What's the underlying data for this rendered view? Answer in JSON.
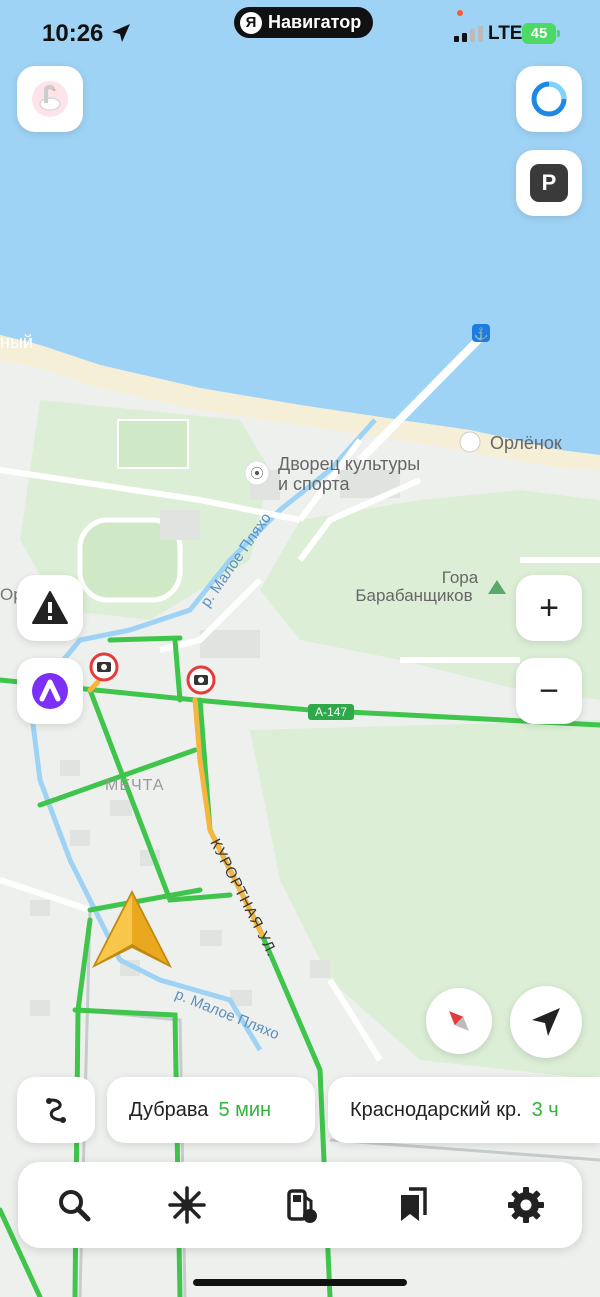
{
  "status_bar": {
    "time": "10:26",
    "app_name": "Навигатор",
    "app_logo_letter": "Я",
    "network": "LTE",
    "battery": "45"
  },
  "map": {
    "labels": {
      "beach_partial": "ный",
      "orlyonok": "Орлёнок",
      "palace_line1": "Дворец культуры",
      "palace_line2": "и спорта",
      "river_upper": "р. Малое Пляхо",
      "mountain_line1": "Гора",
      "mountain_line2": "Барабанщиков",
      "orlyonok_partial": "Орлёнок",
      "route_badge": "А-147",
      "district": "МЕЧТА",
      "street": "КУРОРТНАЯ УЛ.",
      "river_lower": "р. Малое Пляхо"
    },
    "colors": {
      "water": "#9fd3f5",
      "land": "#eef0ee",
      "green_area": "#dcefd6",
      "traffic_free": "#3fc54b",
      "traffic_slow": "#f5b53f",
      "camera": "#e63b3b"
    }
  },
  "route_chips": [
    {
      "name": "Дубрава",
      "eta": "5 мин"
    },
    {
      "name": "Краснодарский кр.",
      "eta": "3 ч"
    }
  ],
  "buttons": {
    "profile": "goose-icon",
    "alice": "alice-ring-icon",
    "parking": "P",
    "road_event": "warning-icon",
    "voice_assistant": "alice-icon",
    "zoom_in": "+",
    "zoom_out": "−",
    "compass": "compass-icon",
    "my_location": "locate-icon",
    "routes": "route-variants-icon"
  },
  "dock": [
    "search-icon",
    "discovery-icon",
    "fuel-icon",
    "bookmarks-icon",
    "settings-icon"
  ]
}
